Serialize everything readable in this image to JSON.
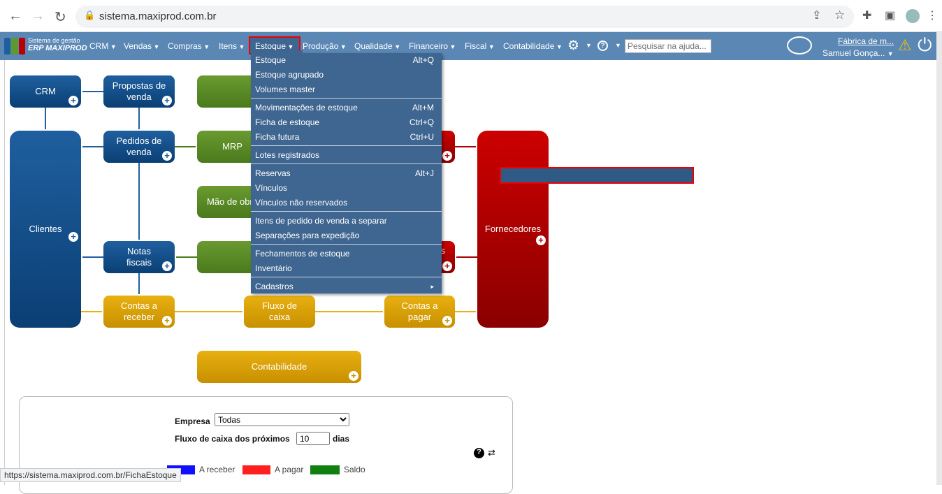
{
  "browser": {
    "url": "sistema.maxiprod.com.br",
    "status_url": "https://sistema.maxiprod.com.br/FichaEstoque"
  },
  "logo": {
    "line1": "Sistema de gestão",
    "line2": "ERP MAXIPROD"
  },
  "nav": {
    "items": [
      "CRM",
      "Vendas",
      "Compras",
      "Itens",
      "Estoque",
      "Produção",
      "Qualidade",
      "Financeiro",
      "Fiscal",
      "Contabilidade"
    ],
    "search_placeholder": "Pesquisar na ajuda...",
    "company": "Fábrica de m...",
    "user": "Samuel Gonça..."
  },
  "menu": [
    {
      "label": "Estoque",
      "key": "Alt+Q"
    },
    {
      "label": "Estoque agrupado",
      "key": ""
    },
    {
      "label": "Volumes master",
      "key": ""
    },
    {
      "label": "Movimentações de estoque",
      "key": "Alt+M"
    },
    {
      "label": "Ficha de estoque",
      "key": "Ctrl+Q"
    },
    {
      "label": "Ficha futura",
      "key": "Ctrl+U"
    },
    {
      "label": "Lotes registrados",
      "key": ""
    },
    {
      "label": "Reservas",
      "key": "Alt+J"
    },
    {
      "label": "Vínculos",
      "key": ""
    },
    {
      "label": "Vínculos não reservados",
      "key": ""
    },
    {
      "label": "Itens de pedido de venda a separar",
      "key": ""
    },
    {
      "label": "Separações para expedição",
      "key": ""
    },
    {
      "label": "Fechamentos de estoque",
      "key": ""
    },
    {
      "label": "Inventário",
      "key": ""
    },
    {
      "label": "Cadastros",
      "key": "▸"
    }
  ],
  "flow": {
    "crm": "CRM",
    "propostas": "Propostas de venda",
    "clientes": "Clientes",
    "pedidos": "Pedidos de venda",
    "mrp": "MRP",
    "mao": "Mão de obra",
    "notas": "Notas fiscais",
    "receber": "Contas a receber",
    "fluxo": "Fluxo de caixa",
    "pagar": "Contas a pagar",
    "fornecedores": "Fornecedores",
    "contabilidade": "Contabilidade",
    "red2_tail": "s"
  },
  "panel": {
    "empresa_label": "Empresa",
    "empresa_value": "Todas",
    "fluxo_label": "Fluxo de caixa dos próximos",
    "dias_value": "10",
    "dias_label": "dias",
    "legend": [
      {
        "label": "A receber",
        "color": "#1010ff"
      },
      {
        "label": "A pagar",
        "color": "#ff2020"
      },
      {
        "label": "Saldo",
        "color": "#108010"
      }
    ]
  }
}
